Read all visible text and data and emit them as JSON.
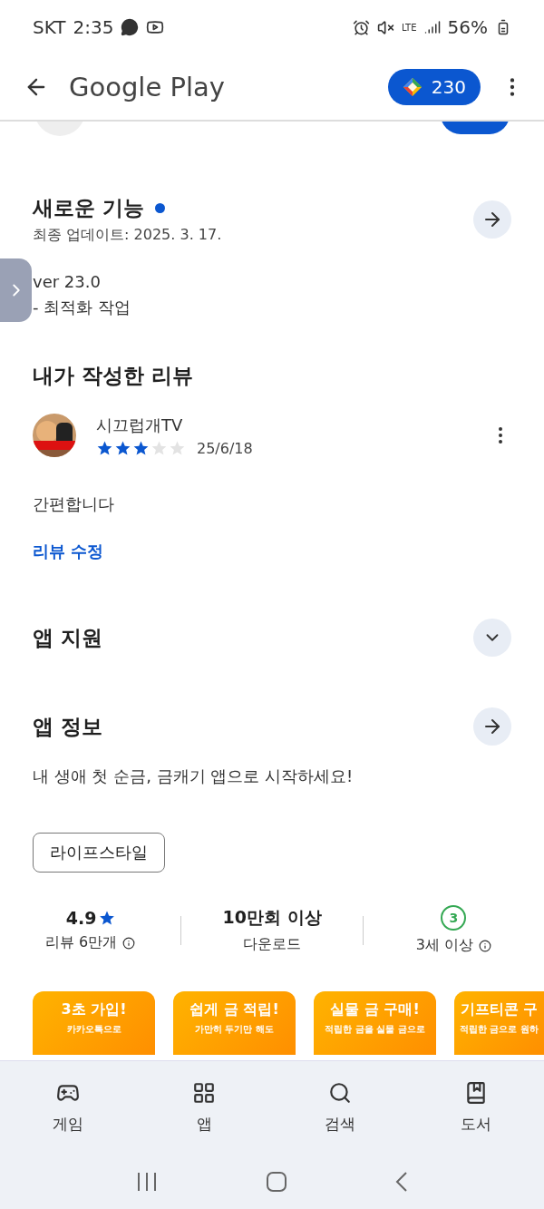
{
  "status_bar": {
    "carrier": "SKT",
    "time": "2:35",
    "network": "LTE",
    "battery": "56%"
  },
  "header": {
    "title": "Google Play",
    "points": "230"
  },
  "whats_new": {
    "title": "새로운 기능",
    "new_indicator": true,
    "updated": "최종 업데이트: 2025. 3. 17.",
    "notes": [
      "ver 23.0",
      "- 최적화 작업"
    ]
  },
  "my_review": {
    "title": "내가 작성한 리뷰",
    "author": "시끄럽개TV",
    "stars": 3,
    "date": "25/6/18",
    "text": "간편합니다",
    "edit_link": "리뷰 수정"
  },
  "app_support": {
    "title": "앱 지원",
    "expanded": false
  },
  "app_info": {
    "title": "앱 정보",
    "description": "내 생애 첫 순금, 금캐기 앱으로 시작하세요!",
    "tag": "라이프스타일"
  },
  "stats": [
    {
      "kind": "rating",
      "value": "4.9",
      "label": "리뷰 6만개"
    },
    {
      "kind": "downloads",
      "value": "10만회 이상",
      "label": "다운로드"
    },
    {
      "kind": "age",
      "value": "3",
      "label": "3세 이상"
    }
  ],
  "promo_cards": [
    {
      "title": "3초 가입!",
      "subtitle": "카카오톡으로"
    },
    {
      "title": "쉽게 금 적립!",
      "subtitle": "가만히 두기만 해도"
    },
    {
      "title": "실물 금 구매!",
      "subtitle": "적립한 금을 실물 금으로"
    },
    {
      "title": "기프티콘 구",
      "subtitle": "적립한 금으로 원하"
    }
  ],
  "bottom_nav": [
    {
      "label": "게임",
      "selected": false
    },
    {
      "label": "앱",
      "selected": false
    },
    {
      "label": "검색",
      "selected": false
    },
    {
      "label": "도서",
      "selected": false
    }
  ]
}
